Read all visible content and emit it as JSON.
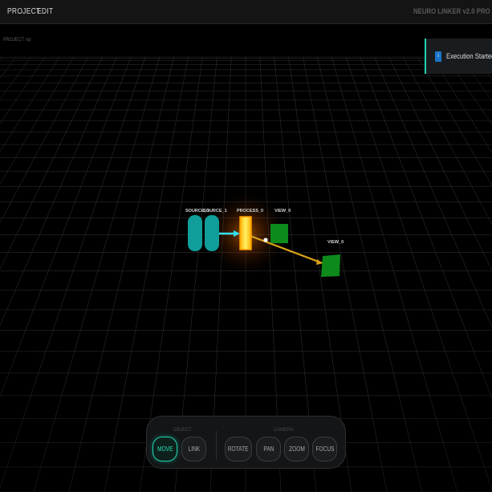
{
  "menu": {
    "project_label": "PROJECT",
    "edit_label": "EDIT",
    "app_title": "NEURO LINKER v2.0 PRO"
  },
  "project": {
    "label": "PROJECT: np"
  },
  "nodes": {
    "source_1_a": "SOURCE_1",
    "source_1_b": "SOURCE_1",
    "processor": "PROCESS_0",
    "view_a": "VIEW_0",
    "view_b": "VIEW_0"
  },
  "toast": {
    "icon_text": "i",
    "message": "Execution Started",
    "accent_color": "#1fd4b0"
  },
  "toolbar": {
    "object_label": "OBJECT",
    "camera_label": "CAMERA",
    "move_label": "MOVE",
    "link_label": "LINK",
    "rotate_label": "ROTATE",
    "pan_label": "PAN",
    "zoom_label": "ZOOM",
    "focus_label": "FOCUS",
    "active_tool": "MOVE"
  },
  "colors": {
    "source": "#0f9e9a",
    "processor": "#ffe02a",
    "view": "#0d8a1a",
    "link_cyan": "#34e0f0",
    "link_orange": "#d9a21c",
    "accent": "#20d3ad"
  }
}
